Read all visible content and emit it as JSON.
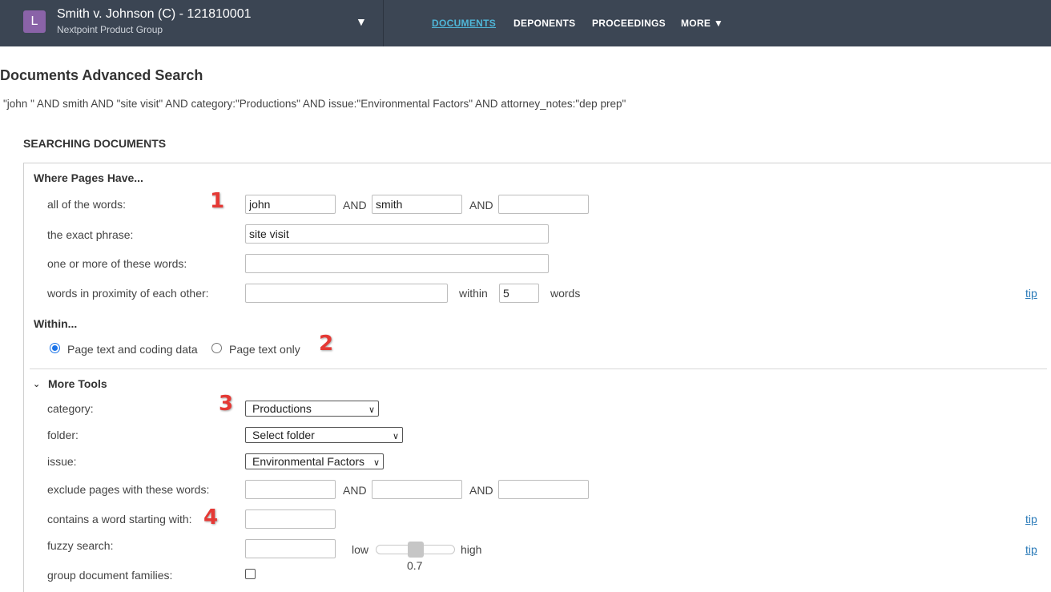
{
  "header": {
    "logo_letter": "L",
    "case_title": "Smith v. Johnson (C) - 121810001",
    "case_subtitle": "Nextpoint Product Group",
    "case_dropdown": "▼",
    "nav": [
      {
        "label": "DOCUMENTS",
        "active": true
      },
      {
        "label": "DEPONENTS",
        "active": false
      },
      {
        "label": "PROCEEDINGS",
        "active": false
      },
      {
        "label": "MORE ▼",
        "active": false
      }
    ]
  },
  "page_title": "Documents Advanced Search",
  "query_string": "\"john \" AND smith AND \"site visit\" AND category:\"Productions\" AND issue:\"Environmental Factors\" AND attorney_notes:\"dep prep\"",
  "section_heading": "SEARCHING DOCUMENTS",
  "where_pages": {
    "heading": "Where Pages Have...",
    "all_words_label": "all of the words:",
    "all_words_values": [
      "john",
      "smith",
      ""
    ],
    "and_label": "AND",
    "exact_phrase_label": "the exact phrase:",
    "exact_phrase_value": "site visit",
    "one_or_more_label": "one or more of these words:",
    "one_or_more_value": "",
    "proximity_label": "words in proximity of each other:",
    "proximity_value": "",
    "within_label": "within",
    "within_value": "5",
    "words_label": "words",
    "tip": "tip"
  },
  "within": {
    "heading": "Within...",
    "options": [
      {
        "label": "Page text and coding data",
        "selected": true
      },
      {
        "label": "Page text only",
        "selected": false
      }
    ]
  },
  "more_tools": {
    "heading": "More Tools",
    "chevron_icon": "chevron-down-icon",
    "category_label": "category:",
    "category_value": "Productions",
    "folder_label": "folder:",
    "folder_value": "Select folder",
    "issue_label": "issue:",
    "issue_value": "Environmental Factors",
    "exclude_label": "exclude pages with these words:",
    "exclude_values": [
      "",
      "",
      ""
    ],
    "starting_label": "contains a word starting with:",
    "starting_value": "",
    "fuzzy_label": "fuzzy search:",
    "fuzzy_value": "",
    "fuzzy_low": "low",
    "fuzzy_high": "high",
    "fuzzy_level": "0.7",
    "group_label": "group document families:",
    "group_checked": false,
    "tip": "tip"
  },
  "annotations": [
    "1",
    "2",
    "3",
    "4"
  ],
  "colors": {
    "topbar": "#3c4654",
    "active_nav": "#4fb6d8",
    "link": "#2a7ab8",
    "callout": "#e53935",
    "logo": "#8a63a8"
  }
}
